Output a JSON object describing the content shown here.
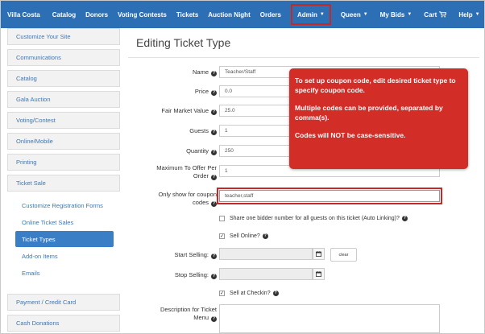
{
  "navbar": {
    "brand": "Villa Costa",
    "items": [
      "Catalog",
      "Donors",
      "Voting Contests",
      "Tickets",
      "Auction Night",
      "Orders"
    ],
    "admin": "Admin",
    "right_items": {
      "user": "Queen",
      "bids": "My Bids",
      "cart": "Cart",
      "help": "Help"
    },
    "colors": {
      "background": "#2c6fb5",
      "highlight": "#c62828"
    }
  },
  "sidebar": {
    "top": [
      "Customize Your Site",
      "Communications",
      "Catalog",
      "Gala Auction",
      "Voting/Contest",
      "Online/Mobile",
      "Printing",
      "Ticket Sale"
    ],
    "sub": [
      "Customize Registration Forms",
      "Online Ticket Sales",
      "Ticket Types",
      "Add-on Items",
      "Emails"
    ],
    "active_sub": "Ticket Types",
    "bottom": [
      "Payment / Credit Card",
      "Cash Donations"
    ]
  },
  "page": {
    "title": "Editing Ticket Type"
  },
  "form": {
    "name": {
      "label": "Name",
      "value": "Teacher/Staff"
    },
    "price": {
      "label": "Price",
      "value": "0.0"
    },
    "fmv": {
      "label": "Fair Market Value",
      "value": "25.0"
    },
    "guests": {
      "label": "Guests",
      "value": "1"
    },
    "quantity": {
      "label": "Quantity",
      "value": "250"
    },
    "max_per_order": {
      "label_line1": "Maximum To Offer Per",
      "label_line2": "Order",
      "value": "1"
    },
    "coupon": {
      "label_line1": "Only show for coupon",
      "label_line2": "codes",
      "value": "teacher,staff"
    },
    "share_bidder": {
      "label": "Share one bidder number for all guests on this ticket (Auto Linking)?",
      "checked": false
    },
    "sell_online": {
      "label": "Sell Online?",
      "checked": true
    },
    "start_selling": {
      "label": "Start Selling:",
      "value": ""
    },
    "stop_selling": {
      "label": "Stop Selling:",
      "value": ""
    },
    "clear_label": "clear",
    "sell_checkin": {
      "label": "Sell at Checkin?",
      "checked": true
    },
    "description": {
      "label_line1": "Description for Ticket",
      "label_line2": "Menu",
      "value": ""
    }
  },
  "callout": {
    "line1": "To set up coupon code, edit desired ticket type to specify coupon code.",
    "line2": "Multiple codes can be provided, separated by comma(s).",
    "line3": "Codes will NOT be case-sensitive.",
    "color": "#d32d27"
  }
}
